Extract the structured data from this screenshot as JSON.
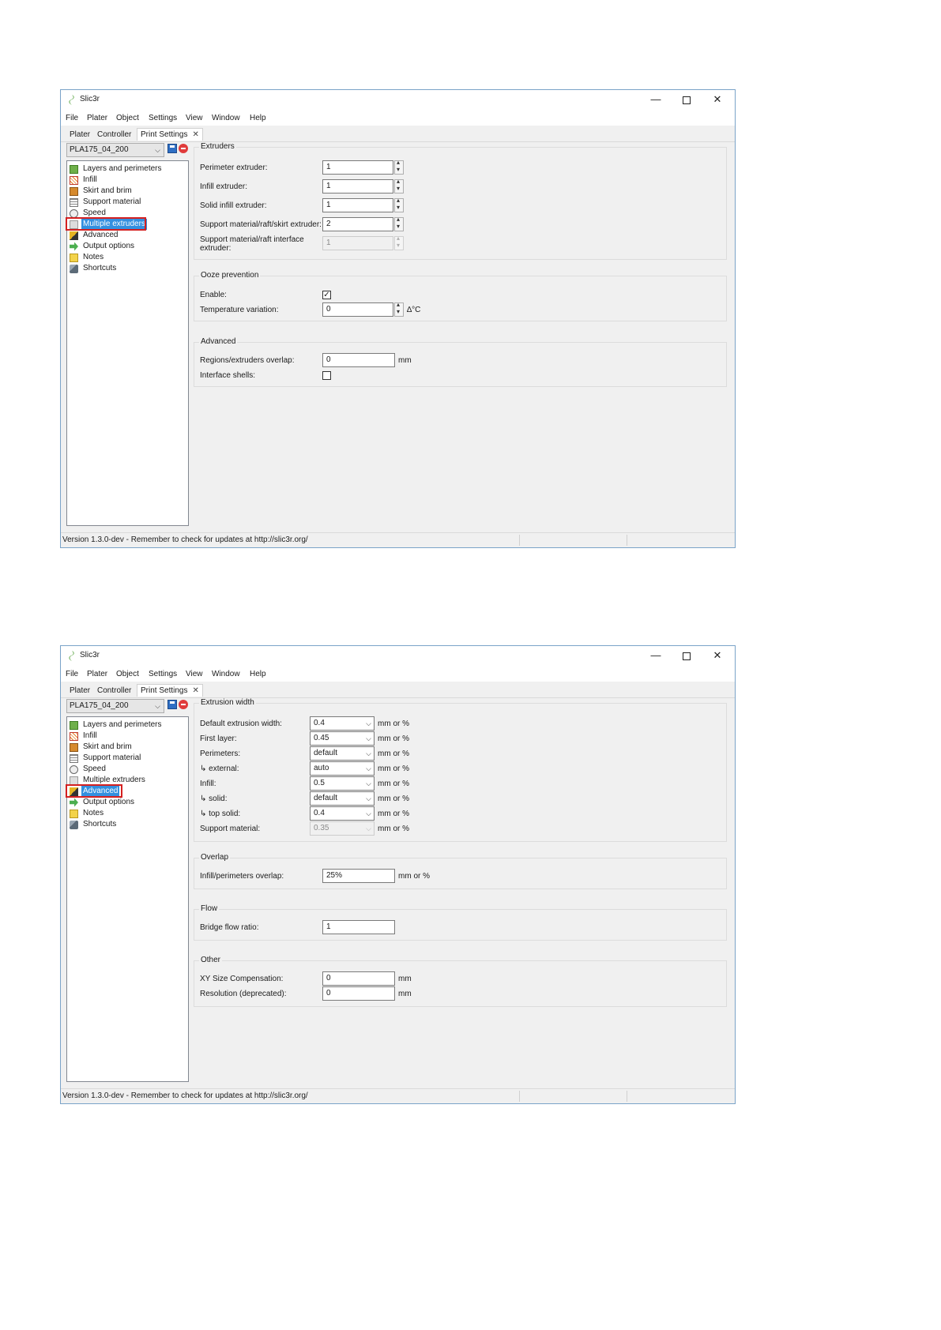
{
  "windows": [
    {
      "title": "Slic3r",
      "menu": [
        "File",
        "Plater",
        "Object",
        "Settings",
        "View",
        "Window",
        "Help"
      ],
      "tabs": [
        "Plater",
        "Controller",
        "Print Settings"
      ],
      "preset": "PLA175_04_200",
      "tree": [
        "Layers and perimeters",
        "Infill",
        "Skirt and brim",
        "Support material",
        "Speed",
        "Multiple extruders",
        "Advanced",
        "Output options",
        "Notes",
        "Shortcuts"
      ],
      "selected_item": "Multiple extruders",
      "groups": [
        {
          "title": "Extruders",
          "rows": [
            {
              "label": "Perimeter extruder:",
              "value": "1"
            },
            {
              "label": "Infill extruder:",
              "value": "1"
            },
            {
              "label": "Solid infill extruder:",
              "value": "1"
            },
            {
              "label": "Support material/raft/skirt extruder:",
              "value": "2"
            },
            {
              "label_line1": "Support material/raft interface",
              "label_line2": "extruder:",
              "value": "1",
              "disabled": true
            }
          ]
        },
        {
          "title": "Ooze prevention",
          "rows": [
            {
              "label": "Enable:",
              "checked": true
            },
            {
              "label": "Temperature variation:",
              "value": "0",
              "unit": "∆°C"
            }
          ]
        },
        {
          "title": "Advanced",
          "rows": [
            {
              "label": "Regions/extruders overlap:",
              "value": "0",
              "unit": "mm"
            },
            {
              "label": "Interface shells:",
              "checked": false
            }
          ]
        }
      ],
      "status": "Version 1.3.0-dev - Remember to check for updates at http://slic3r.org/"
    },
    {
      "title": "Slic3r",
      "menu": [
        "File",
        "Plater",
        "Object",
        "Settings",
        "View",
        "Window",
        "Help"
      ],
      "tabs": [
        "Plater",
        "Controller",
        "Print Settings"
      ],
      "preset": "PLA175_04_200",
      "tree": [
        "Layers and perimeters",
        "Infill",
        "Skirt and brim",
        "Support material",
        "Speed",
        "Multiple extruders",
        "Advanced",
        "Output options",
        "Notes",
        "Shortcuts"
      ],
      "selected_item": "Advanced",
      "groups": [
        {
          "title": "Extrusion width",
          "rows": [
            {
              "label": "Default extrusion width:",
              "value": "0.4",
              "unit": "mm or %"
            },
            {
              "label": "First layer:",
              "value": "0.45",
              "unit": "mm or %"
            },
            {
              "label": "Perimeters:",
              "value": "default",
              "unit": "mm or %"
            },
            {
              "label": "↳ external:",
              "value": "auto",
              "unit": "mm or %"
            },
            {
              "label": "Infill:",
              "value": "0.5",
              "unit": "mm or %"
            },
            {
              "label": "↳ solid:",
              "value": "default",
              "unit": "mm or %"
            },
            {
              "label": "↳ top solid:",
              "value": "0.4",
              "unit": "mm or %"
            },
            {
              "label": "Support material:",
              "value": "0.35",
              "unit": "mm or %",
              "disabled": true
            }
          ]
        },
        {
          "title": "Overlap",
          "rows": [
            {
              "label": "Infill/perimeters overlap:",
              "value": "25%",
              "unit": "mm or %"
            }
          ]
        },
        {
          "title": "Flow",
          "rows": [
            {
              "label": "Bridge flow ratio:",
              "value": "1"
            }
          ]
        },
        {
          "title": "Other",
          "rows": [
            {
              "label": "XY Size Compensation:",
              "value": "0",
              "unit": "mm"
            },
            {
              "label": "Resolution (deprecated):",
              "value": "0",
              "unit": "mm"
            }
          ]
        }
      ],
      "status": "Version 1.3.0-dev - Remember to check for updates at http://slic3r.org/"
    }
  ],
  "colors": {
    "selection": "#3390e0",
    "highlight_border": "#d42020",
    "window_border": "#7aa3c8"
  },
  "icons": [
    "slic3r-app-icon",
    "save-icon",
    "delete-icon",
    "layers-icon",
    "infill-icon",
    "skirt-icon",
    "support-icon",
    "speed-icon",
    "extruder-icon",
    "wrench-icon",
    "output-icon",
    "notes-icon",
    "shortcuts-icon"
  ]
}
